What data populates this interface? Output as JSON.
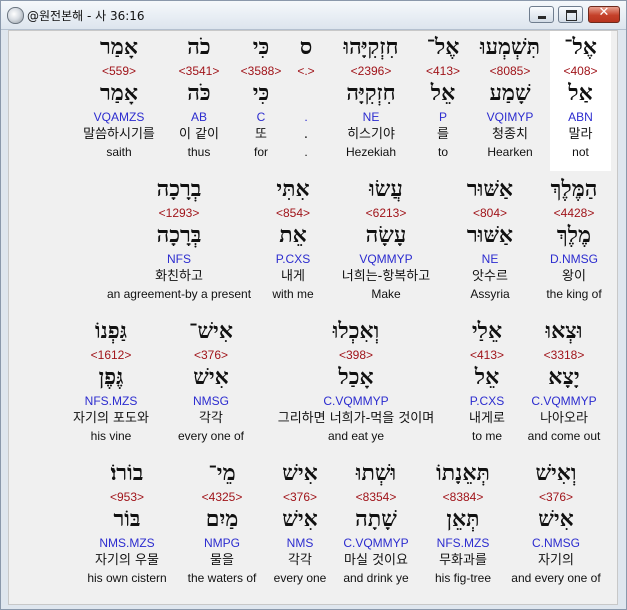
{
  "window": {
    "title": "@원전본해 - 사 36:16",
    "icon": "app-icon",
    "close_label": "✕"
  },
  "rows": [
    {
      "words": [
        {
          "heb": "אֶל־",
          "num": "<408>",
          "root": "אַל",
          "parse": "ABN",
          "kor": "말라",
          "eng": "not",
          "highlight": true
        },
        {
          "heb": "תִּשְׁמְעוּ",
          "num": "<8085>",
          "root": "שָׁמַע",
          "parse": "VQIMYP",
          "kor": "청종치",
          "eng": "Hearken"
        },
        {
          "heb": "אֶל־",
          "num": "<413>",
          "root": "אֵל",
          "parse": "P",
          "kor": "를",
          "eng": "to"
        },
        {
          "heb": "חִזְקִיָּהוּ",
          "num": "<2396>",
          "root": "חִזְקִיָּה",
          "parse": "NE",
          "kor": "히스기야",
          "eng": "Hezekiah"
        },
        {
          "heb": "ס",
          "num": "<.>",
          "root": "",
          "parse": ".",
          "kor": ".",
          "eng": "."
        },
        {
          "heb": "כִּי",
          "num": "<3588>",
          "root": "כִּי",
          "parse": "C",
          "kor": "또",
          "eng": "for"
        },
        {
          "heb": "כֹה",
          "num": "<3541>",
          "root": "כֹּה",
          "parse": "AB",
          "kor": "이 같이",
          "eng": "thus"
        },
        {
          "heb": "אָמַר",
          "num": "<559>",
          "root": "אָמַר",
          "parse": "VQAMZS",
          "kor": "말씀하시기를",
          "eng": "saith"
        }
      ]
    },
    {
      "words": [
        {
          "heb": "הַמֶּלֶךְ",
          "num": "<4428>",
          "root": "מֶלֶךְ",
          "parse": "D.NMSG",
          "kor": "왕이",
          "eng": "the king of"
        },
        {
          "heb": "אַשּׁוּר",
          "num": "<804>",
          "root": "אַשּׁוּר",
          "parse": "NE",
          "kor": "앗수르",
          "eng": "Assyria"
        },
        {
          "heb": "עֲשׂוּ",
          "num": "<6213>",
          "root": "עָשָׂה",
          "parse": "VQMMYP",
          "kor": "너희는-항복하고",
          "eng": "Make"
        },
        {
          "heb": "אִתִּי",
          "num": "<854>",
          "root": "אֵת",
          "parse": "P.CXS",
          "kor": "내게",
          "eng": "with me"
        },
        {
          "heb": "בְרָכָה",
          "num": "<1293>",
          "root": "בְּרָכָה",
          "parse": "NFS",
          "kor": "화친하고",
          "eng": "an agreement-by a present"
        }
      ]
    },
    {
      "words": [
        {
          "heb": "וּצְאוּ",
          "num": "<3318>",
          "root": "יָצָא",
          "parse": "C.VQMMYP",
          "kor": "나아오라",
          "eng": "and come out"
        },
        {
          "heb": "אֵלַי",
          "num": "<413>",
          "root": "אֵל",
          "parse": "P.CXS",
          "kor": "내게로",
          "eng": "to me"
        },
        {
          "heb": "וְאִכְלוּ",
          "num": "<398>",
          "root": "אָכַל",
          "parse": "C.VQMMYP",
          "kor": "그리하면 너희가-먹을 것이며",
          "eng": "and eat ye"
        },
        {
          "heb": "אִישׁ־",
          "num": "<376>",
          "root": "אִישׁ",
          "parse": "NMSG",
          "kor": "각각",
          "eng": "every one of"
        },
        {
          "heb": "גַּפְנוֹ",
          "num": "<1612>",
          "root": "גֶּפֶן",
          "parse": "NFS.MZS",
          "kor": "자기의 포도와",
          "eng": "his vine"
        }
      ]
    },
    {
      "words": [
        {
          "heb": "וְאִישׁ",
          "num": "<376>",
          "root": "אִישׁ",
          "parse": "C.NMSG",
          "kor": "자기의",
          "eng": "and every one of"
        },
        {
          "heb": "תְּאֵנָתוֹ",
          "num": "<8384>",
          "root": "תְּאֵן",
          "parse": "NFS.MZS",
          "kor": "무화과를",
          "eng": "his fig-tree"
        },
        {
          "heb": "וּשְׁתוּ",
          "num": "<8354>",
          "root": "שָׁתָה",
          "parse": "C.VQMMYP",
          "kor": "마실 것이요",
          "eng": "and drink ye"
        },
        {
          "heb": "אִישׁ",
          "num": "<376>",
          "root": "אִישׁ",
          "parse": "NMS",
          "kor": "각각",
          "eng": "every one"
        },
        {
          "heb": "מֵי־",
          "num": "<4325>",
          "root": "מַיִם",
          "parse": "NMPG",
          "kor": "물을",
          "eng": "the waters of"
        },
        {
          "heb": "בוֹרוֹ׃",
          "num": "<953>",
          "root": "בּוֹר",
          "parse": "NMS.MZS",
          "kor": "자기의 우물",
          "eng": "his own cistern"
        }
      ]
    }
  ]
}
